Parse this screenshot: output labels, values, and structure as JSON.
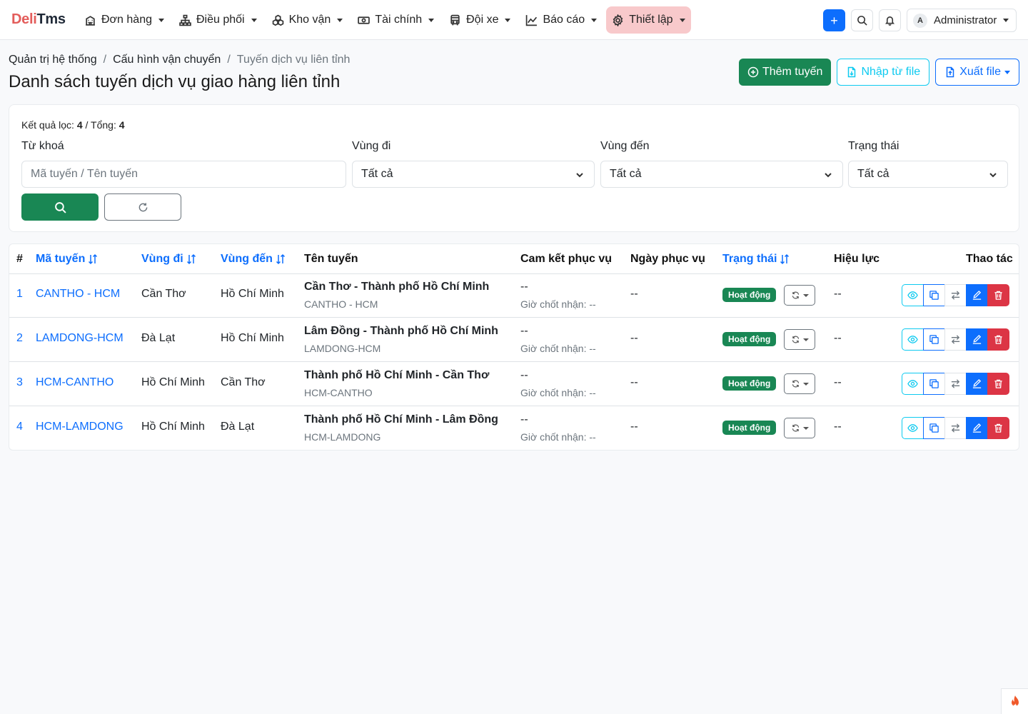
{
  "brand": {
    "part1": "Deli",
    "part2": "Tms"
  },
  "nav": {
    "items": [
      {
        "label": "Đơn hàng",
        "icon": "building-icon"
      },
      {
        "label": "Điều phối",
        "icon": "diagram-icon"
      },
      {
        "label": "Kho vận",
        "icon": "boxes-icon"
      },
      {
        "label": "Tài chính",
        "icon": "cash-icon"
      },
      {
        "label": "Đội xe",
        "icon": "bus-icon"
      },
      {
        "label": "Báo cáo",
        "icon": "graph-icon"
      },
      {
        "label": "Thiết lập",
        "icon": "gear-icon",
        "active": true
      }
    ],
    "add_label": "+",
    "user": {
      "initial": "A",
      "name": "Administrator"
    }
  },
  "breadcrumb": [
    "Quản trị hệ thống",
    "Cấu hình vận chuyển",
    "Tuyến dịch vụ liên tỉnh"
  ],
  "page_title": "Danh sách tuyến dịch vụ giao hàng liên tỉnh",
  "header_actions": {
    "add_label": "Thêm tuyến",
    "import_label": "Nhập từ file",
    "export_label": "Xuất file"
  },
  "filter": {
    "result_label": "Kết quả lọc:",
    "result_count": "4",
    "total_label": "/ Tổng:",
    "total_count": "4",
    "keyword_label": "Từ khoá",
    "keyword_placeholder": "Mã tuyến / Tên tuyến",
    "from_label": "Vùng đi",
    "from_value": "Tất cả",
    "to_label": "Vùng đến",
    "to_value": "Tất cả",
    "status_label": "Trạng thái",
    "status_value": "Tất cả"
  },
  "table": {
    "columns": {
      "idx": "#",
      "code": "Mã tuyến",
      "from": "Vùng đi",
      "to": "Vùng đến",
      "name": "Tên tuyến",
      "commit": "Cam kết phục vụ",
      "days": "Ngày phục vụ",
      "status": "Trạng thái",
      "effective": "Hiệu lực",
      "actions": "Thao tác"
    },
    "rows": [
      {
        "idx": "1",
        "code": "CANTHO - HCM",
        "from": "Cần Thơ",
        "to": "Hồ Chí Minh",
        "name": "Cần Thơ - Thành phố Hồ Chí Minh",
        "name_code": "CANTHO - HCM",
        "commit": "--",
        "cutoff": "Giờ chốt nhận: --",
        "days": "--",
        "status": "Hoạt động",
        "effective": "--"
      },
      {
        "idx": "2",
        "code": "LAMDONG-HCM",
        "from": "Đà Lạt",
        "to": "Hồ Chí Minh",
        "name": "Lâm Đồng - Thành phố Hồ Chí Minh",
        "name_code": "LAMDONG-HCM",
        "commit": "--",
        "cutoff": "Giờ chốt nhận: --",
        "days": "--",
        "status": "Hoạt động",
        "effective": "--"
      },
      {
        "idx": "3",
        "code": "HCM-CANTHO",
        "from": "Hồ Chí Minh",
        "to": "Cần Thơ",
        "name": "Thành phố Hồ Chí Minh - Cần Thơ",
        "name_code": "HCM-CANTHO",
        "commit": "--",
        "cutoff": "Giờ chốt nhận: --",
        "days": "--",
        "status": "Hoạt động",
        "effective": "--"
      },
      {
        "idx": "4",
        "code": "HCM-LAMDONG",
        "from": "Hồ Chí Minh",
        "to": "Đà Lạt",
        "name": "Thành phố Hồ Chí Minh - Lâm Đồng",
        "name_code": "HCM-LAMDONG",
        "commit": "--",
        "cutoff": "Giờ chốt nhận: --",
        "days": "--",
        "status": "Hoạt động",
        "effective": "--"
      }
    ]
  },
  "colors": {
    "brand_red": "#e35d5b",
    "success": "#198754",
    "primary": "#0d6efd",
    "info": "#0dcaf0",
    "danger": "#dc3545",
    "active_menu_bg": "#f8c9cb"
  }
}
